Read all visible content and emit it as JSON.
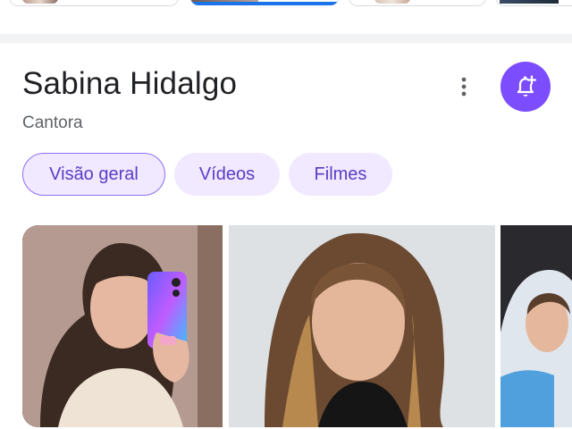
{
  "entity": {
    "name": "Sabina Hidalgo",
    "description": "Cantora"
  },
  "actions": {
    "more_icon": "more-vert-icon",
    "follow_icon": "bell-add-icon",
    "follow_color": "#7c4dff"
  },
  "tabs": [
    {
      "label": "Visão geral",
      "active": true
    },
    {
      "label": "Vídeos",
      "active": false
    },
    {
      "label": "Filmes",
      "active": false
    }
  ],
  "colors": {
    "chip_bg": "#f1e9ff",
    "chip_text": "#5b3cc4",
    "chip_border": "#8e6ef5",
    "top_active_bar": "#1a73e8"
  }
}
